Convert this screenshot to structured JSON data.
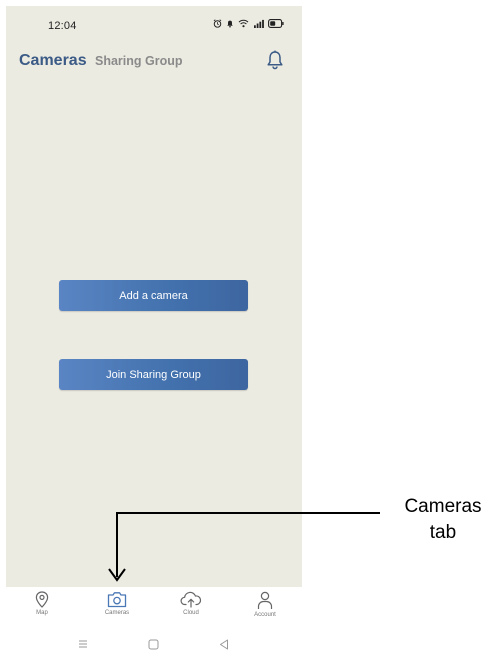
{
  "status_bar": {
    "time": "12:04"
  },
  "header": {
    "tab_cameras": "Cameras",
    "tab_sharing_group": "Sharing Group"
  },
  "main": {
    "add_camera_label": "Add a camera",
    "join_sharing_label": "Join Sharing Group"
  },
  "bottom_nav": {
    "items": [
      {
        "label": "Map",
        "icon": "map-pin-icon"
      },
      {
        "label": "Cameras",
        "icon": "camera-icon"
      },
      {
        "label": "Cloud",
        "icon": "cloud-upload-icon"
      },
      {
        "label": "Account",
        "icon": "person-icon"
      }
    ]
  },
  "annotation": {
    "line1": "Cameras",
    "line2": "tab"
  },
  "colors": {
    "screen_background": "#ecebe2",
    "brand_blue": "#3b5b86",
    "button_blue": "#4a77b5",
    "active_nav": "#4a77b5"
  }
}
